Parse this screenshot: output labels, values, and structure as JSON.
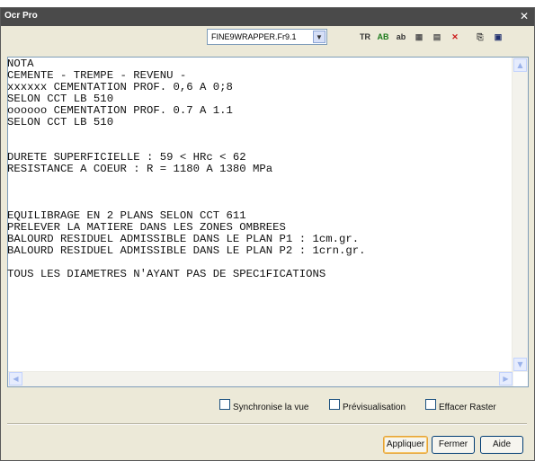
{
  "window": {
    "title": "Ocr Pro",
    "close_glyph": "✕"
  },
  "toolbar": {
    "wrapper_select": {
      "value": "FINE9WRAPPER.Fr9.1"
    },
    "icons": [
      {
        "name": "tr-icon",
        "glyph": "TR",
        "color": "#333333"
      },
      {
        "name": "ab-format-icon",
        "glyph": "AB",
        "color": "#1a7a1a"
      },
      {
        "name": "text-block-icon",
        "glyph": "ab",
        "color": "#333333"
      },
      {
        "name": "select-zone-icon",
        "glyph": "▦",
        "color": "#555555"
      },
      {
        "name": "zone-clear-icon",
        "glyph": "▤",
        "color": "#555555"
      },
      {
        "name": "delete-icon",
        "glyph": "✕",
        "color": "#cc1a1a"
      },
      {
        "name": "copy-icon",
        "glyph": "⎘",
        "color": "#333333"
      },
      {
        "name": "save-icon",
        "glyph": "▣",
        "color": "#1f2f6e"
      }
    ]
  },
  "ocr_text": "NOTA\nCEMENTE - TREMPE - REVENU -\nxxxxxx CEMENTATION PROF. 0,6 A 0;8\nSELON CCT LB 510\noooooo CEMENTATION PROF. 0.7 A 1.1\nSELON CCT LB 510\n\n\nDURETE SUPERFICIELLE : 59 < HRc < 62\nRESISTANCE A COEUR : R = 1180 A 1380 MPa\n\n\n\nEQUILIBRAGE EN 2 PLANS SELON CCT 611\nPRELEVER LA MATIERE DANS LES ZONES OMBREES\nBALOURD RESIDUEL ADMISSIBLE DANS LE PLAN P1 : 1cm.gr.\nBALOURD RESIDUEL ADMISSIBLE DANS LE PLAN P2 : 1crn.gr.\n\nTOUS LES DIAMETRES N'AYANT PAS DE SPEC1FICATIONS",
  "options": {
    "sync_view": {
      "label": "Synchronise la vue",
      "checked": false
    },
    "preview": {
      "label": "Prévisualisation",
      "checked": false
    },
    "erase_raster": {
      "label": "Effacer Raster",
      "checked": false
    }
  },
  "buttons": {
    "apply": "Appliquer",
    "close": "Fermer",
    "help": "Aide"
  },
  "colors": {
    "titlebar": "#4a4a4a",
    "dialog_bg": "#ece9d8",
    "default_button_border": "#e5a33a"
  }
}
